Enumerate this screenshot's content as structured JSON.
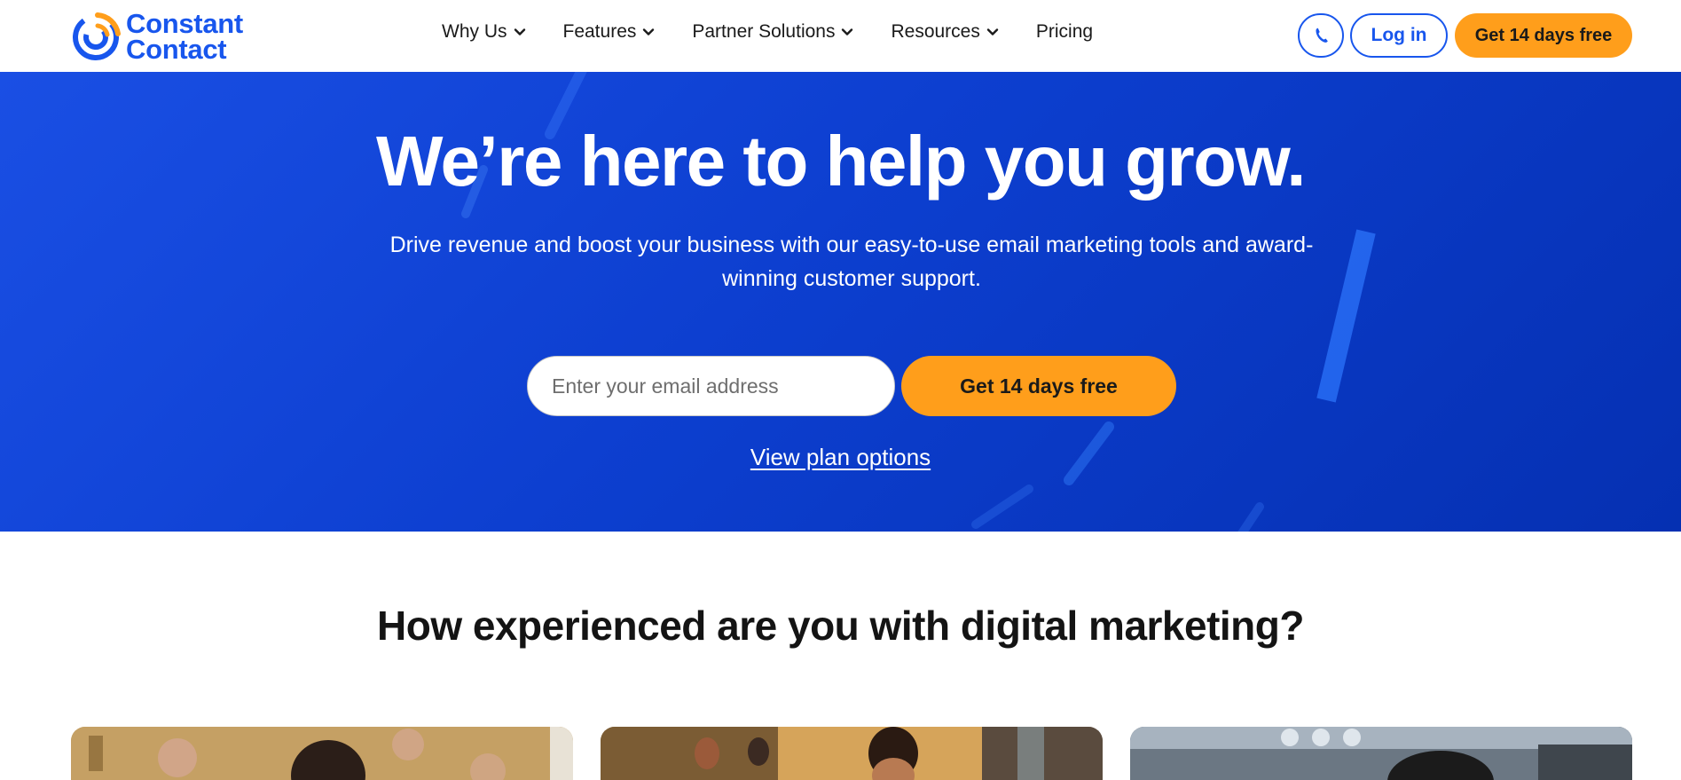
{
  "header": {
    "logo": {
      "line1": "Constant",
      "line2": "Contact",
      "icon": "constant-contact-logo-icon"
    },
    "nav": [
      {
        "label": "Why Us",
        "has_dropdown": true
      },
      {
        "label": "Features",
        "has_dropdown": true
      },
      {
        "label": "Partner Solutions",
        "has_dropdown": true
      },
      {
        "label": "Resources",
        "has_dropdown": true
      },
      {
        "label": "Pricing",
        "has_dropdown": false
      }
    ],
    "phone_icon": "phone-icon",
    "login_label": "Log in",
    "trial_label": "Get 14 days free"
  },
  "hero": {
    "title": "We’re here to help you grow.",
    "subtitle": "Drive revenue and boost your business with our easy-to-use email marketing tools and award-winning customer support.",
    "email_placeholder": "Enter your email address",
    "email_value": "",
    "cta_label": "Get 14 days free",
    "view_plans_label": "View plan options"
  },
  "section": {
    "title": "How experienced are you with digital marketing?",
    "cards": [
      {
        "image": "woman-in-decorated-room-photo"
      },
      {
        "image": "man-in-restaurant-photo"
      },
      {
        "image": "person-in-workshop-photo"
      }
    ]
  },
  "colors": {
    "brand_blue": "#1856ed",
    "accent_orange": "#ff9e1b",
    "hero_blue": "#0d3fd0"
  }
}
